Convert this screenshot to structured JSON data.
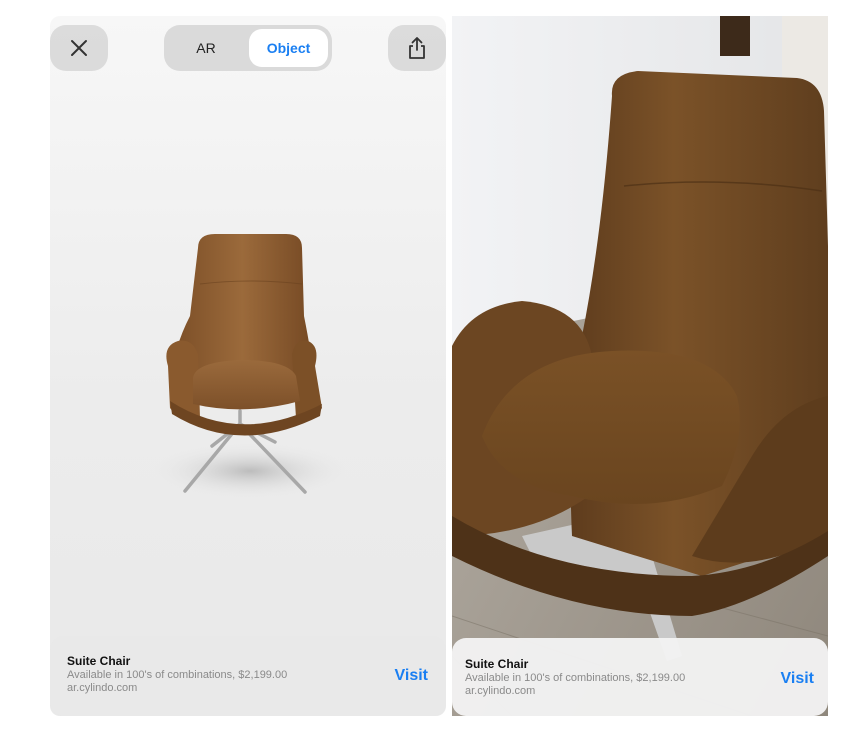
{
  "left_view": {
    "segments": {
      "ar_label": "AR",
      "object_label": "Object",
      "selected": "Object"
    },
    "close_icon": "close-x-icon",
    "share_icon": "share-icon",
    "card": {
      "title": "Suite Chair",
      "subtitle": "Available in 100's of combinations, $2,199.00",
      "domain": "ar.cylindo.com",
      "action": "Visit"
    }
  },
  "right_view": {
    "card": {
      "title": "Suite Chair",
      "subtitle": "Available in 100's of combinations, $2,199.00",
      "domain": "ar.cylindo.com",
      "action": "Visit"
    }
  },
  "colors": {
    "accent": "#1a7ff2",
    "chair_leather": "#8a5a2e",
    "chair_leather_dark": "#5e3d1c"
  }
}
